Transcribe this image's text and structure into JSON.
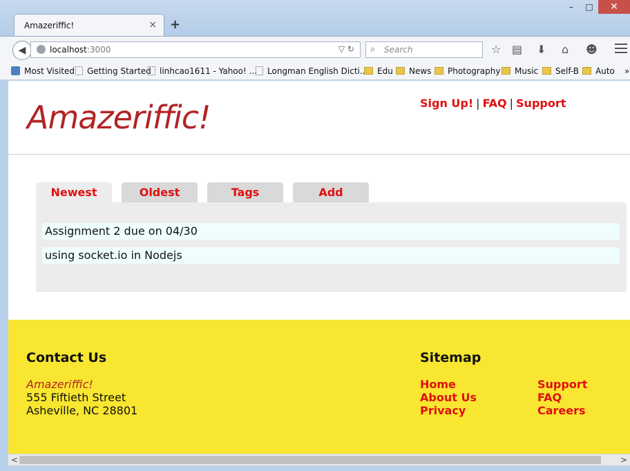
{
  "browser": {
    "tab_title": "Amazeriffic!",
    "tab_close": "×",
    "new_tab": "+",
    "url_host": "localhost",
    "url_port": ":3000",
    "search_placeholder": "Search",
    "window_controls": {
      "minimize": "–",
      "maximize": "□",
      "close": "✕"
    },
    "bookmarks": [
      {
        "label": "Most Visited",
        "icon": "most-visited-icon"
      },
      {
        "label": "Getting Started",
        "icon": "page-icon"
      },
      {
        "label": "linhcao1611 - Yahoo! ...",
        "icon": "page-icon"
      },
      {
        "label": "Longman English Dicti...",
        "icon": "page-icon"
      },
      {
        "label": "Edu",
        "icon": "folder-icon"
      },
      {
        "label": "News",
        "icon": "folder-icon"
      },
      {
        "label": "Photography",
        "icon": "folder-icon"
      },
      {
        "label": "Music",
        "icon": "folder-icon"
      },
      {
        "label": "Self-B",
        "icon": "folder-icon"
      },
      {
        "label": "Auto",
        "icon": "folder-icon"
      }
    ],
    "bookmarks_overflow": "»"
  },
  "site": {
    "title": "Amazeriffic!",
    "top_links": [
      "Sign Up!",
      "FAQ",
      "Support"
    ],
    "separator": "|",
    "tabs": [
      "Newest",
      "Oldest",
      "Tags",
      "Add"
    ],
    "active_tab": "Newest",
    "todos": [
      "Assignment 2 due on 04/30",
      "using socket.io in Nodejs"
    ]
  },
  "footer": {
    "contact_heading": "Contact Us",
    "brand": "Amazeriffic!",
    "address_line1": "555 Fiftieth Street",
    "address_line2": "Asheville, NC 28801",
    "sitemap_heading": "Sitemap",
    "sitemap_col1": [
      "Home",
      "About Us",
      "Privacy"
    ],
    "sitemap_col2": [
      "Support",
      "FAQ",
      "Careers"
    ]
  },
  "colors": {
    "brand_red": "#b22424",
    "link_red": "#e01010",
    "footer_yellow": "#f8e630",
    "todo_bg": "#effdfd"
  }
}
